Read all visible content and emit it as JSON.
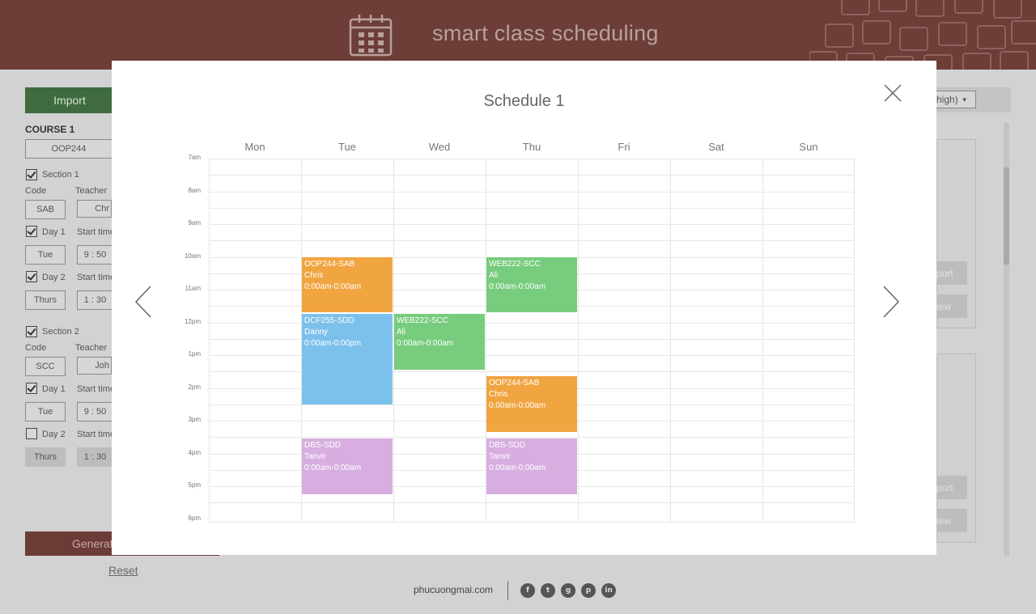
{
  "header": {
    "title": "smart class scheduling"
  },
  "background": {
    "import_label": "Import",
    "course_heading": "COURSE 1",
    "course_code": "OOP244",
    "section1": {
      "label": "Section 1",
      "code_label": "Code",
      "teacher_label": "Teacher",
      "code": "SAB",
      "teacher": "Chr",
      "day1_label": "Day 1",
      "day1_start_label": "Start time",
      "day1_value": "Tue",
      "day1_time": "9 : 50",
      "day2_label": "Day 2",
      "day2_start_label": "Start time",
      "day2_value": "Thurs",
      "day2_time": "1 : 30"
    },
    "section2": {
      "label": "Section 2",
      "code_label": "Code",
      "teacher_label": "Teacher",
      "code": "SCC",
      "teacher": "Joh",
      "day1_label": "Day 1",
      "day1_start_label": "Start time",
      "day1_value": "Tue",
      "day1_time": "9 : 50",
      "day2_label": "Day 2",
      "day2_start_label": "Start time",
      "day2_value": "Thurs",
      "day2_time": "1 : 30"
    },
    "generate_label": "Generat",
    "reset_label": "Reset",
    "priority_select": "high)",
    "right_panel_buttons": [
      "port",
      "iew",
      "port",
      "iew"
    ]
  },
  "footer": {
    "site": "phucuongmai.com",
    "social": [
      "f",
      "t",
      "g",
      "p",
      "in"
    ],
    "social_icons": [
      "facebook-icon",
      "twitter-icon",
      "github-icon",
      "pinterest-icon",
      "linkedin-icon"
    ]
  },
  "modal": {
    "title": "Schedule 1",
    "days": [
      "Mon",
      "Tue",
      "Wed",
      "Thu",
      "Fri",
      "Sat",
      "Sun"
    ],
    "times": [
      "7am",
      "8am",
      "9am",
      "10am",
      "11am",
      "12pm",
      "1pm",
      "2pm",
      "3pm",
      "4pm",
      "5pm",
      "6pm"
    ],
    "events": [
      {
        "title": "OOP244-SAB",
        "teacher": "Chris",
        "time": "0:00am-0:00am",
        "day": "Tue",
        "start": 10.0,
        "end": 11.7,
        "color": "#f0a541"
      },
      {
        "title": "DCF255-SDD",
        "teacher": "Danny",
        "time": "0:00am-0:00pm",
        "day": "Tue",
        "start": 11.75,
        "end": 14.5,
        "color": "#7cc1ec"
      },
      {
        "title": "DBS-SDD",
        "teacher": "Tanvir",
        "time": "0:00am-0:00am",
        "day": "Tue",
        "start": 15.55,
        "end": 17.25,
        "color": "#d7aedf"
      },
      {
        "title": "WEB222-SCC",
        "teacher": "Ali",
        "time": "0:00am-0:00am",
        "day": "Wed",
        "start": 11.75,
        "end": 13.45,
        "color": "#78cc7e"
      },
      {
        "title": "WEB222-SCC",
        "teacher": "Ali",
        "time": "0:00am-0:00am",
        "day": "Thu",
        "start": 10.0,
        "end": 11.7,
        "color": "#78cc7e"
      },
      {
        "title": "OOP244-SAB",
        "teacher": "Chris",
        "time": "0:00am-0:00am",
        "day": "Thu",
        "start": 13.65,
        "end": 15.35,
        "color": "#f0a541"
      },
      {
        "title": "DBS-SDD",
        "teacher": "Tanvir",
        "time": "0:00am-0:00am",
        "day": "Thu",
        "start": 15.55,
        "end": 17.25,
        "color": "#d7aedf"
      }
    ]
  }
}
